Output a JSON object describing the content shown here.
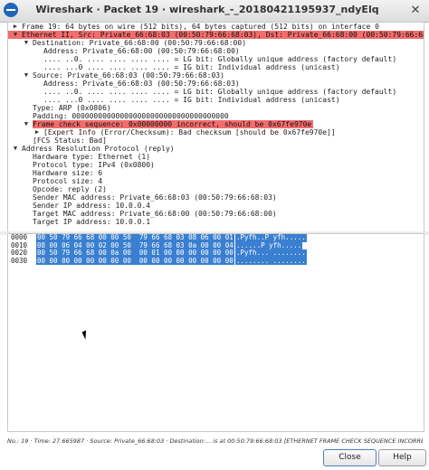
{
  "window": {
    "title": "Wireshark · Packet 19 · wireshark_-_20180421195937_ndyElq",
    "close_glyph": "✕"
  },
  "tree": [
    {
      "indent": 0,
      "arrow": "right",
      "text": "Frame 19: 64 bytes on wire (512 bits), 64 bytes captured (512 bits) on interface 0",
      "err": false
    },
    {
      "indent": 0,
      "arrow": "down",
      "text": "Ethernet II, Src: Private_66:68:03 (00:50:79:66:68:03), Dst: Private_66:68:00 (00:50:79:66:68:00)",
      "err": true
    },
    {
      "indent": 1,
      "arrow": "down",
      "text": "Destination: Private_66:68:00 (00:50:79:66:68:00)",
      "err": false
    },
    {
      "indent": 2,
      "arrow": "",
      "text": "Address: Private_66:68:00 (00:50:79:66:68:00)",
      "err": false
    },
    {
      "indent": 2,
      "arrow": "",
      "text": ".... ..0. .... .... .... .... = LG bit: Globally unique address (factory default)",
      "err": false
    },
    {
      "indent": 2,
      "arrow": "",
      "text": ".... ...0 .... .... .... .... = IG bit: Individual address (unicast)",
      "err": false
    },
    {
      "indent": 1,
      "arrow": "down",
      "text": "Source: Private_66:68:03 (00:50:79:66:68:03)",
      "err": false
    },
    {
      "indent": 2,
      "arrow": "",
      "text": "Address: Private_66:68:03 (00:50:79:66:68:03)",
      "err": false
    },
    {
      "indent": 2,
      "arrow": "",
      "text": ".... ..0. .... .... .... .... = LG bit: Globally unique address (factory default)",
      "err": false
    },
    {
      "indent": 2,
      "arrow": "",
      "text": ".... ...0 .... .... .... .... = IG bit: Individual address (unicast)",
      "err": false
    },
    {
      "indent": 1,
      "arrow": "",
      "text": "Type: ARP (0x0806)",
      "err": false
    },
    {
      "indent": 1,
      "arrow": "",
      "text": "Padding: 000000000000000000000000000000000000",
      "err": false
    },
    {
      "indent": 1,
      "arrow": "down",
      "text": "Frame check sequence: 0x00000000 incorrect, should be 0x67fe970e",
      "err": true
    },
    {
      "indent": 2,
      "arrow": "right",
      "text": "[Expert Info (Error/Checksum): Bad checksum [should be 0x67fe970e]]",
      "err": false
    },
    {
      "indent": 1,
      "arrow": "",
      "text": "[FCS Status: Bad]",
      "err": false
    },
    {
      "indent": 0,
      "arrow": "down",
      "text": "Address Resolution Protocol (reply)",
      "err": false
    },
    {
      "indent": 1,
      "arrow": "",
      "text": "Hardware type: Ethernet (1)",
      "err": false
    },
    {
      "indent": 1,
      "arrow": "",
      "text": "Protocol type: IPv4 (0x0800)",
      "err": false
    },
    {
      "indent": 1,
      "arrow": "",
      "text": "Hardware size: 6",
      "err": false
    },
    {
      "indent": 1,
      "arrow": "",
      "text": "Protocol size: 4",
      "err": false
    },
    {
      "indent": 1,
      "arrow": "",
      "text": "Opcode: reply (2)",
      "err": false
    },
    {
      "indent": 1,
      "arrow": "",
      "text": "Sender MAC address: Private_66:68:03 (00:50:79:66:68:03)",
      "err": false
    },
    {
      "indent": 1,
      "arrow": "",
      "text": "Sender IP address: 10.0.0.4",
      "err": false
    },
    {
      "indent": 1,
      "arrow": "",
      "text": "Target MAC address: Private_66:68:00 (00:50:79:66:68:00)",
      "err": false
    },
    {
      "indent": 1,
      "arrow": "",
      "text": "Target IP address: 10.0.0.1",
      "err": false
    }
  ],
  "hex": [
    {
      "offset": "0000",
      "bytes": "00 50 79 66 68 00 00 50  79 66 68 03 08 06 00 01",
      "ascii": ".Pyfh..P yfh....."
    },
    {
      "offset": "0010",
      "bytes": "08 00 06 04 00 02 00 50  79 66 68 03 0a 00 00 04",
      "ascii": "......P yfh....."
    },
    {
      "offset": "0020",
      "bytes": "00 50 79 66 68 00 0a 00  00 01 00 00 00 00 00 00",
      "ascii": ".Pyfh... ........"
    },
    {
      "offset": "0030",
      "bytes": "00 00 00 00 00 00 00 00  00 00 00 00 00 00 00 00",
      "ascii": "........ ........"
    }
  ],
  "status": "No.: 19 · Time: 27.665987 · Source: Private_66:68:03 · Destination:... is at 00:50:79:66:68:03 [ETHERNET FRAME CHECK SEQUENCE INCORRECT]",
  "buttons": {
    "close": "Close",
    "help": "Help"
  },
  "colors": {
    "error_highlight": "#f26d6d",
    "selection": "#3a7fd0"
  }
}
